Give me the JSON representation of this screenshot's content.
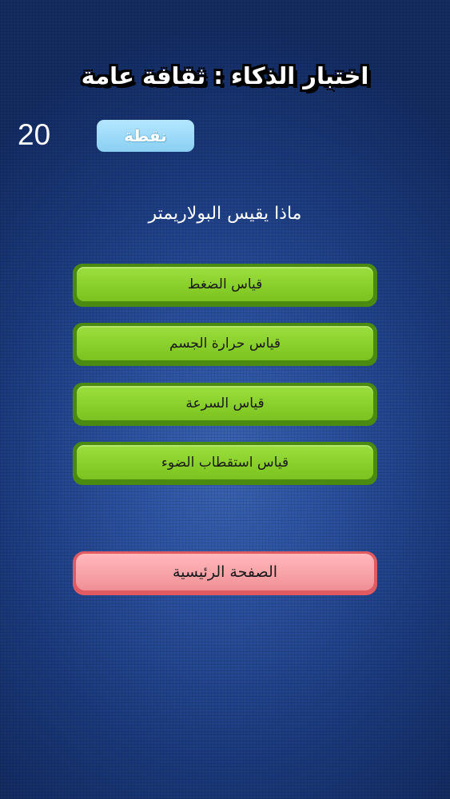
{
  "header": {
    "title": "اختبار الذكاء : ثقافة عامة"
  },
  "score": {
    "value": "20",
    "badge_label": "نقطة"
  },
  "question": {
    "text": "ماذا يقيس البولاريمتر"
  },
  "answers": [
    {
      "label": "قياس الضغط"
    },
    {
      "label": "قياس حرارة الجسم"
    },
    {
      "label": "قياس السرعة"
    },
    {
      "label": "قياس استقطاب الضوء"
    }
  ],
  "home_button": {
    "label": "الصفحة الرئيسية"
  },
  "colors": {
    "background": "#2a4f9c",
    "answer_button": "#8ad02c",
    "home_button": "#f7a1a6",
    "badge": "#9fdcf8"
  }
}
